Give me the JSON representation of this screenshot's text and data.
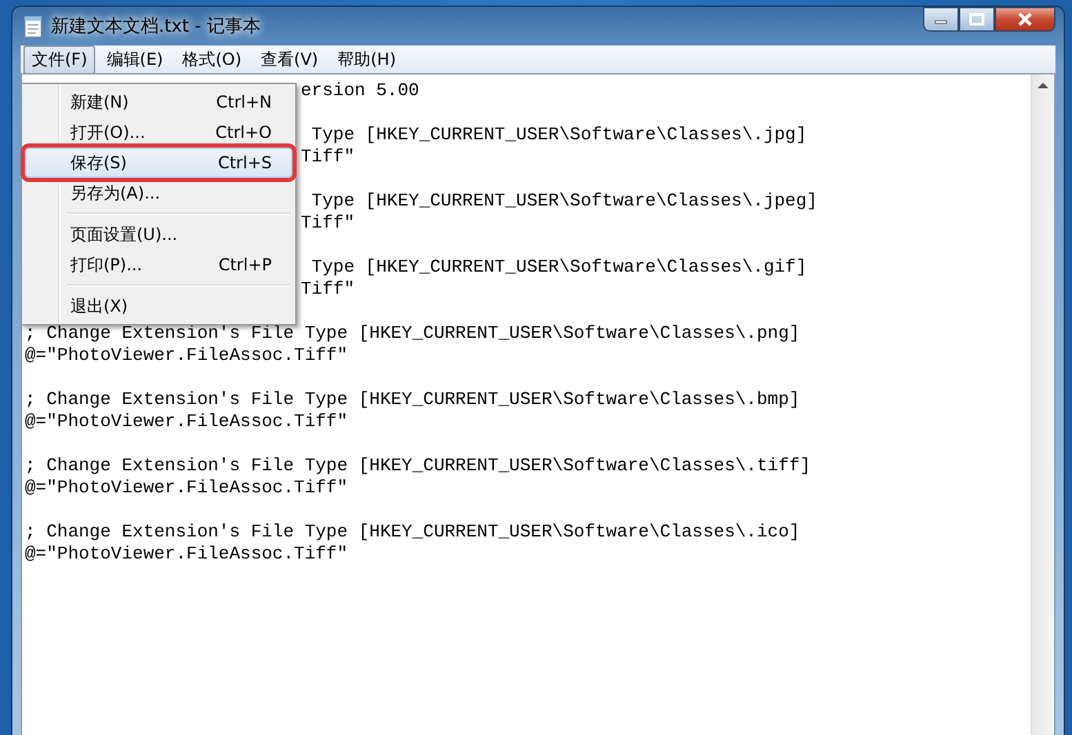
{
  "window": {
    "title": "新建文本文档.txt - 记事本"
  },
  "menu_bar": [
    {
      "label": "文件(F)",
      "selected": true
    },
    {
      "label": "编辑(E)",
      "selected": false
    },
    {
      "label": "格式(O)",
      "selected": false
    },
    {
      "label": "查看(V)",
      "selected": false
    },
    {
      "label": "帮助(H)",
      "selected": false
    }
  ],
  "file_menu": [
    {
      "kind": "item",
      "label": "新建(N)",
      "shortcut": "Ctrl+N",
      "selected": false
    },
    {
      "kind": "item",
      "label": "打开(O)...",
      "shortcut": "Ctrl+O",
      "selected": false
    },
    {
      "kind": "item",
      "label": "保存(S)",
      "shortcut": "Ctrl+S",
      "selected": true,
      "outlined": true
    },
    {
      "kind": "item",
      "label": "另存为(A)...",
      "selected": false
    },
    {
      "kind": "separator"
    },
    {
      "kind": "item",
      "label": "页面设置(U)...",
      "selected": false
    },
    {
      "kind": "item",
      "label": "打印(P)...",
      "shortcut": "Ctrl+P",
      "selected": false
    },
    {
      "kind": "separator"
    },
    {
      "kind": "item",
      "label": "退出(X)",
      "selected": false
    }
  ],
  "editor_lines": [
    {
      "kind": "partial",
      "text": "ersion 5.00"
    },
    {
      "kind": "blank"
    },
    {
      "kind": "partial",
      "text": " Type [HKEY_CURRENT_USER\\Software\\Classes\\.jpg]"
    },
    {
      "kind": "partial",
      "text": "Tiff\""
    },
    {
      "kind": "blank"
    },
    {
      "kind": "partial",
      "text": " Type [HKEY_CURRENT_USER\\Software\\Classes\\.jpeg]"
    },
    {
      "kind": "partial",
      "text": "Tiff\""
    },
    {
      "kind": "blank"
    },
    {
      "kind": "partial",
      "text": " Type [HKEY_CURRENT_USER\\Software\\Classes\\.gif]"
    },
    {
      "kind": "partial",
      "text": "Tiff\""
    },
    {
      "kind": "blank"
    },
    {
      "kind": "full",
      "text": "; Change Extension's File Type [HKEY_CURRENT_USER\\Software\\Classes\\.png]"
    },
    {
      "kind": "full",
      "text": "@=\"PhotoViewer.FileAssoc.Tiff\""
    },
    {
      "kind": "blank"
    },
    {
      "kind": "full",
      "text": "; Change Extension's File Type [HKEY_CURRENT_USER\\Software\\Classes\\.bmp]"
    },
    {
      "kind": "full",
      "text": "@=\"PhotoViewer.FileAssoc.Tiff\""
    },
    {
      "kind": "blank"
    },
    {
      "kind": "full",
      "text": "; Change Extension's File Type [HKEY_CURRENT_USER\\Software\\Classes\\.tiff]"
    },
    {
      "kind": "full",
      "text": "@=\"PhotoViewer.FileAssoc.Tiff\""
    },
    {
      "kind": "blank"
    },
    {
      "kind": "full",
      "text": "; Change Extension's File Type [HKEY_CURRENT_USER\\Software\\Classes\\.ico]"
    },
    {
      "kind": "full",
      "text": "@=\"PhotoViewer.FileAssoc.Tiff\""
    }
  ]
}
